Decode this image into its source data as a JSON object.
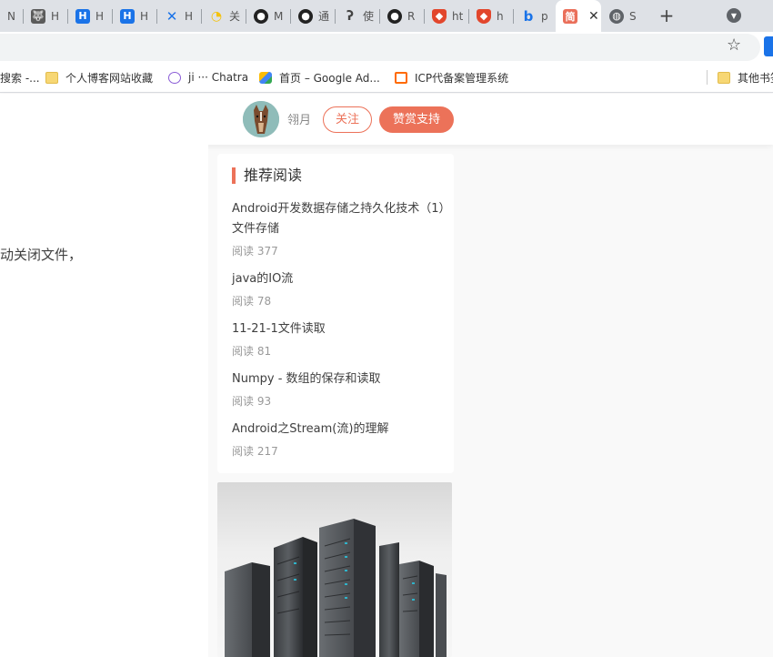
{
  "tabs": [
    {
      "label": "N",
      "favicon": "generic-icon",
      "color": "#777"
    },
    {
      "label": "H",
      "favicon": "wolf-icon",
      "color": "#555"
    },
    {
      "label": "H",
      "favicon": "h-logo-icon",
      "color": "#1a73e8"
    },
    {
      "label": "Н",
      "favicon": "h-logo-icon",
      "color": "#1a73e8"
    },
    {
      "label": "H",
      "favicon": "x-logo-icon",
      "color": "#1a73e8"
    },
    {
      "label": "关",
      "favicon": "sun-icon",
      "color": "#f4c20d"
    },
    {
      "label": "M",
      "favicon": "github-icon",
      "color": "#222"
    },
    {
      "label": "通",
      "favicon": "github-icon",
      "color": "#222"
    },
    {
      "label": "使",
      "favicon": "swirl-icon",
      "color": "#444"
    },
    {
      "label": "R",
      "favicon": "github-icon",
      "color": "#222"
    },
    {
      "label": "ht",
      "favicon": "shield-icon",
      "color": "#e2462c"
    },
    {
      "label": "h",
      "favicon": "shield-icon",
      "color": "#e2462c"
    },
    {
      "label": "p",
      "favicon": "bing-icon",
      "color": "#1a73e8"
    },
    {
      "label": "简",
      "favicon": "jianshu-icon",
      "color": "#ea6f5a",
      "active": true
    },
    {
      "label": "S",
      "favicon": "globe-icon",
      "color": "#5f6368"
    }
  ],
  "bookmarks": {
    "items": [
      {
        "label": "搜索 -...",
        "icon": "none"
      },
      {
        "label": "个人博客网站收藏",
        "icon": "folder-icon"
      },
      {
        "label": "ji ··· Chatra",
        "icon": "chat-icon"
      },
      {
        "label": "首页 – Google Ad...",
        "icon": "google-ads-icon"
      },
      {
        "label": "ICP代备案管理系统",
        "icon": "aliyun-icon"
      }
    ],
    "other": "其他书签"
  },
  "header": {
    "author_name": "翎月",
    "follow_label": "关注",
    "reward_label": "赞赏支持"
  },
  "article": {
    "fragment": "动关闭文件，"
  },
  "recommended": {
    "title": "推荐阅读",
    "items": [
      {
        "title": "Android开发数据存储之持久化技术（1）文件存储",
        "meta": "阅读 377"
      },
      {
        "title": "java的IO流",
        "meta": "阅读 78"
      },
      {
        "title": "11-21-1文件读取",
        "meta": "阅读 81"
      },
      {
        "title": "Numpy - 数组的保存和读取",
        "meta": "阅读 93"
      },
      {
        "title": "Android之Stream(流)的理解",
        "meta": "阅读 217"
      }
    ]
  },
  "colors": {
    "accent": "#ec7259",
    "tabstrip": "#dee1e6"
  }
}
